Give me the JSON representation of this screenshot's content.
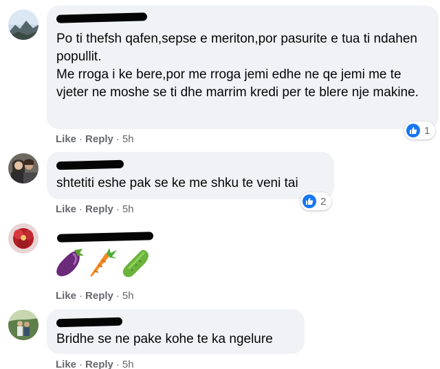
{
  "comments": [
    {
      "avatar_icon": "mountain-landscape-avatar",
      "text": "Po ti thefsh qafen,sepse e meriton,por pasurite e tua ti ndahen popullit.\nMe rroga i ke bere,por me rroga jemi edhe ne qe jemi me te vjeter ne moshe se ti dhe marrim kredi per te blere nje makine.",
      "reaction_icon": "like-icon",
      "reaction_count": "1",
      "like_label": "Like",
      "reply_label": "Reply",
      "separator": "·",
      "time": "5h"
    },
    {
      "avatar_icon": "couple-photo-avatar",
      "text": "shtetiti eshe pak se ke me shku te veni tai",
      "reaction_icon": "like-icon",
      "reaction_count": "2",
      "like_label": "Like",
      "reply_label": "Reply",
      "separator": "·",
      "time": "5h"
    },
    {
      "avatar_icon": "red-flower-avatar",
      "emojis": [
        "eggplant-emoji",
        "carrot-emoji",
        "cucumber-emoji"
      ],
      "like_label": "Like",
      "reply_label": "Reply",
      "separator": "·",
      "time": "5h"
    },
    {
      "avatar_icon": "outdoor-people-avatar",
      "text": "Bridhe se ne pake kohe te ka ngelure",
      "like_label": "Like",
      "reply_label": "Reply",
      "separator": "·",
      "time": "5h"
    }
  ],
  "colors": {
    "bubble": "#f0f2f5",
    "text": "#050505",
    "meta": "#65676b",
    "like_blue": "#1877f2"
  }
}
